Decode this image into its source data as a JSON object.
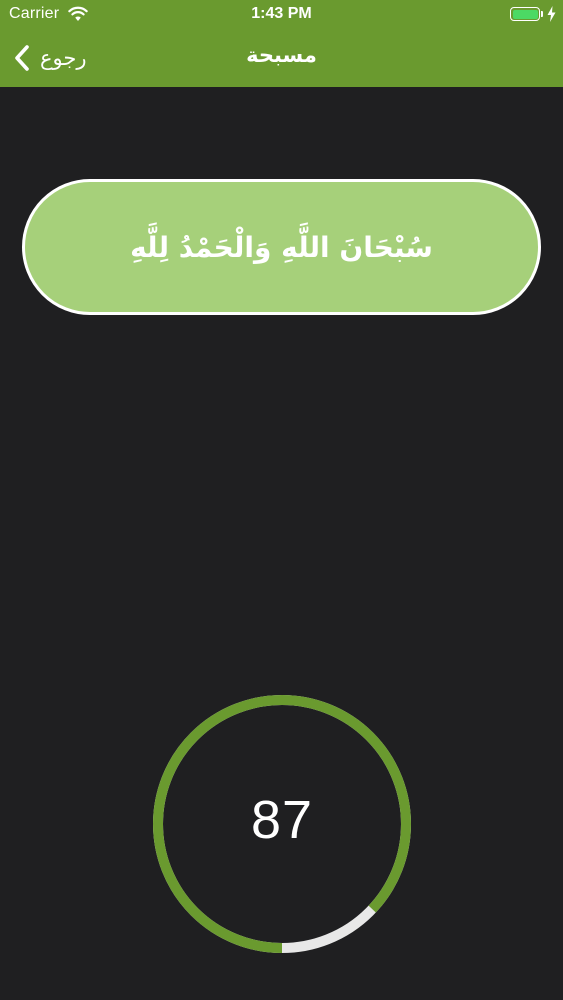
{
  "status_bar": {
    "carrier": "Carrier",
    "time": "1:43 PM",
    "wifi_icon": "wifi-icon",
    "battery_icon": "battery-full-icon",
    "charging_icon": "charging-bolt-icon",
    "battery_fill_color": "#4CD964"
  },
  "nav": {
    "title": "مسبحة",
    "back_label": "رجوع",
    "back_icon": "chevron-left-icon",
    "background_color": "#6A9A2F"
  },
  "dhikr": {
    "text": "سُبْحَانَ اللَّهِ وَالْحَمْدُ لِلَّهِ",
    "background_color": "#A6D07A"
  },
  "counter": {
    "value": "87",
    "progress_fraction": 0.87,
    "ring_color": "#6A9A2F",
    "track_color": "#E8E8E8"
  },
  "theme": {
    "page_background": "#1F1F21"
  }
}
